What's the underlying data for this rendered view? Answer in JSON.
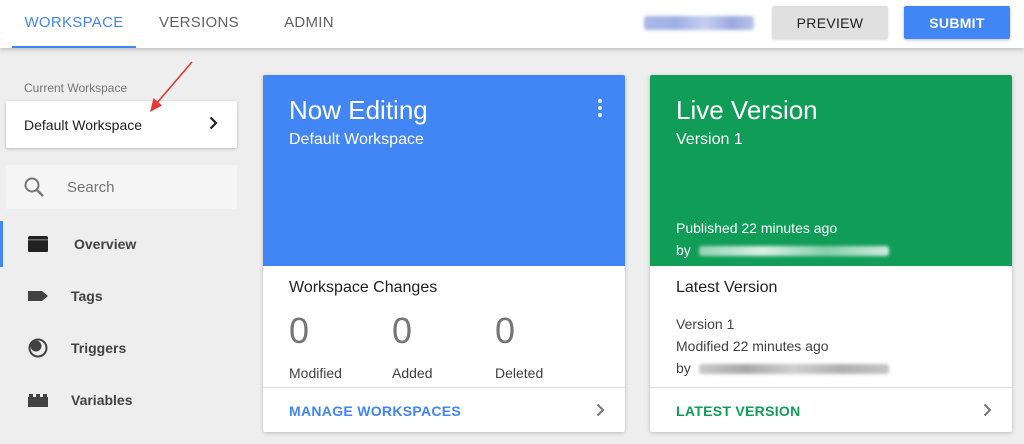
{
  "tabs": [
    {
      "label": "WORKSPACE",
      "active": true
    },
    {
      "label": "VERSIONS",
      "active": false
    },
    {
      "label": "ADMIN",
      "active": false
    }
  ],
  "header": {
    "preview_label": "PREVIEW",
    "submit_label": "SUBMIT"
  },
  "sidebar": {
    "current_workspace_label": "Current Workspace",
    "workspace_name": "Default Workspace",
    "search_placeholder": "Search",
    "items": [
      {
        "label": "Overview",
        "icon": "folder-icon",
        "active": true
      },
      {
        "label": "Tags",
        "icon": "tag-icon",
        "active": false
      },
      {
        "label": "Triggers",
        "icon": "trigger-icon",
        "active": false
      },
      {
        "label": "Variables",
        "icon": "variables-icon",
        "active": false
      }
    ]
  },
  "workspace_card": {
    "title": "Now Editing",
    "subtitle": "Default Workspace",
    "changes_title": "Workspace Changes",
    "stats": [
      {
        "value": "0",
        "label": "Modified"
      },
      {
        "value": "0",
        "label": "Added"
      },
      {
        "value": "0",
        "label": "Deleted"
      }
    ],
    "footer_label": "MANAGE WORKSPACES"
  },
  "live_card": {
    "title": "Live Version",
    "subtitle": "Version 1",
    "published": "Published 22 minutes ago",
    "by_prefix": "by",
    "latest_title": "Latest Version",
    "latest_version": "Version 1",
    "latest_modified": "Modified 22 minutes ago",
    "latest_by_prefix": "by",
    "footer_label": "LATEST VERSION"
  },
  "colors": {
    "accent_blue": "#4285f4",
    "live_green": "#0f9d58",
    "annotation_red": "#e53935"
  }
}
